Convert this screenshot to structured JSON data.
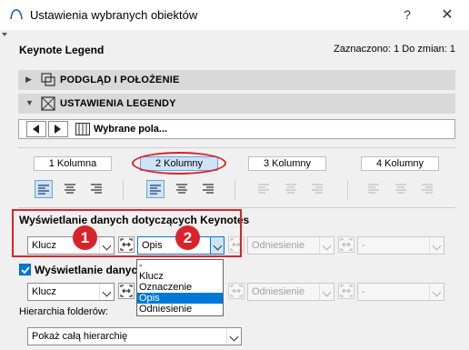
{
  "window": {
    "title": "Ustawienia wybranych obiektów",
    "help_label": "?",
    "close_label": "✕"
  },
  "header": {
    "panel_title": "Keynote Legend",
    "status": "Zaznaczono: 1 Do zmian: 1"
  },
  "sections": [
    {
      "label": "PODGLĄD I POŁOŻENIE",
      "expanded": false,
      "icon": "preview-position-icon"
    },
    {
      "label": "USTAWIENIA LEGENDY",
      "expanded": true,
      "icon": "legend-settings-icon"
    }
  ],
  "nav": {
    "current": "Wybrane pola...",
    "prev_icon": "triangle-left-icon",
    "next_icon": "triangle-right-icon"
  },
  "columns": [
    {
      "label": "1 Kolumna",
      "selected": false
    },
    {
      "label": "2 Kolumny",
      "selected": true
    },
    {
      "label": "3 Kolumny",
      "selected": false
    },
    {
      "label": "4 Kolumny",
      "selected": false
    }
  ],
  "keynote_section": {
    "title": "Wyświetlanie danych dotyczących Keynotes",
    "field1_value": "Klucz",
    "field2_value": "Opis",
    "field3_value": "Odniesienie",
    "field4_value": "-"
  },
  "second_section": {
    "checkbox_label": "Wyświetlanie danych",
    "checked": true,
    "field1_value": "Klucz",
    "field3_value": "Odniesienie",
    "field4_value": "-"
  },
  "dropdown": {
    "options": [
      "-",
      "Klucz",
      "Oznaczenie",
      "Opis",
      "Odniesienie"
    ],
    "highlighted_index": 3
  },
  "hierarchy": {
    "label": "Hierarchia folderów:",
    "value": "Pokaż całą hierarchię"
  },
  "annotations": {
    "badge1": "1",
    "badge2": "2",
    "highlight_color": "#d9232a"
  },
  "colors": {
    "accent": "#0078d7",
    "section_bg": "#d9d9d9"
  }
}
